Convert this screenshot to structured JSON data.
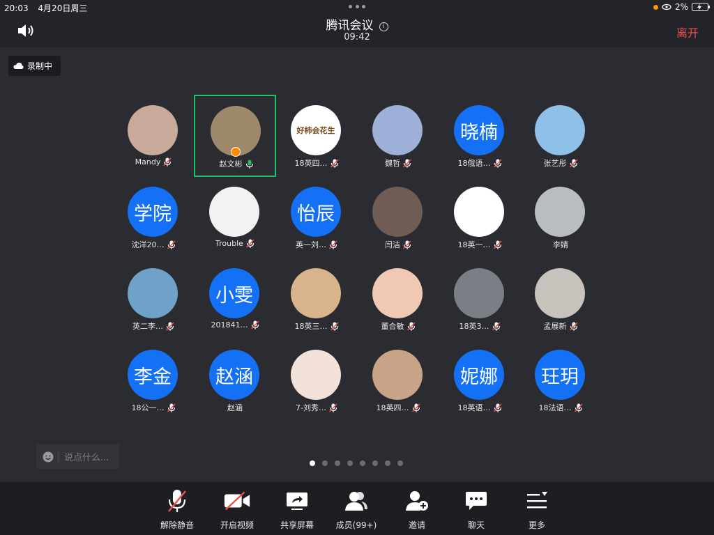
{
  "status_bar": {
    "time": "20:03",
    "date": "4月20日周三",
    "battery_percent": "2%"
  },
  "header": {
    "title": "腾讯会议",
    "timer": "09:42",
    "leave_label": "离开"
  },
  "recording_badge": "录制中",
  "participants": [
    {
      "name": "Mandy",
      "avatar_text": "",
      "avatar_color": "#c9a99a",
      "mic": "muted",
      "speaking": false
    },
    {
      "name": "赵文彬",
      "avatar_text": "",
      "avatar_color": "#9e8a6a",
      "mic": "on",
      "speaking": true
    },
    {
      "name": "18英四…",
      "avatar_text": "好柿会花生",
      "avatar_color": "#ffffff",
      "mic": "muted",
      "speaking": false
    },
    {
      "name": "魏哲",
      "avatar_text": "",
      "avatar_color": "#9fb0d8",
      "mic": "muted",
      "speaking": false
    },
    {
      "name": "18俄语…",
      "avatar_text": "晓楠",
      "avatar_color": "#1470f5",
      "mic": "muted",
      "speaking": false
    },
    {
      "name": "张艺彤",
      "avatar_text": "",
      "avatar_color": "#8fc0e8",
      "mic": "muted",
      "speaking": false
    },
    {
      "name": "沈洋20…",
      "avatar_text": "学院",
      "avatar_color": "#1470f5",
      "mic": "muted",
      "speaking": false
    },
    {
      "name": "Trouble",
      "avatar_text": "",
      "avatar_color": "#f2f2f2",
      "mic": "muted",
      "speaking": false
    },
    {
      "name": "英一刘…",
      "avatar_text": "怡辰",
      "avatar_color": "#1470f5",
      "mic": "muted",
      "speaking": false
    },
    {
      "name": "闫洁",
      "avatar_text": "",
      "avatar_color": "#6e5c55",
      "mic": "muted",
      "speaking": false
    },
    {
      "name": "18英一…",
      "avatar_text": "",
      "avatar_color": "#ffffff",
      "mic": "muted",
      "speaking": false
    },
    {
      "name": "李婧",
      "avatar_text": "",
      "avatar_color": "#b9bcc0",
      "mic": "none",
      "speaking": false
    },
    {
      "name": "英二李…",
      "avatar_text": "",
      "avatar_color": "#6fa2c8",
      "mic": "muted",
      "speaking": false
    },
    {
      "name": "201841…",
      "avatar_text": "小雯",
      "avatar_color": "#1470f5",
      "mic": "muted",
      "speaking": false
    },
    {
      "name": "18英三…",
      "avatar_text": "",
      "avatar_color": "#d9b48a",
      "mic": "muted",
      "speaking": false
    },
    {
      "name": "董合敏",
      "avatar_text": "",
      "avatar_color": "#f0c8b4",
      "mic": "muted",
      "speaking": false
    },
    {
      "name": "18英3…",
      "avatar_text": "",
      "avatar_color": "#7a7f86",
      "mic": "muted",
      "speaking": false
    },
    {
      "name": "孟展新",
      "avatar_text": "",
      "avatar_color": "#c8c2bc",
      "mic": "muted",
      "speaking": false
    },
    {
      "name": "18公一…",
      "avatar_text": "李金",
      "avatar_color": "#1470f5",
      "mic": "muted",
      "speaking": false
    },
    {
      "name": "赵涵",
      "avatar_text": "赵涵",
      "avatar_color": "#1470f5",
      "mic": "none",
      "speaking": false
    },
    {
      "name": "7-刘秀…",
      "avatar_text": "",
      "avatar_color": "#f3e2da",
      "mic": "muted",
      "speaking": false
    },
    {
      "name": "18英四…",
      "avatar_text": "",
      "avatar_color": "#c9a388",
      "mic": "muted",
      "speaking": false
    },
    {
      "name": "18英语…",
      "avatar_text": "妮娜",
      "avatar_color": "#1470f5",
      "mic": "muted",
      "speaking": false
    },
    {
      "name": "18法语…",
      "avatar_text": "玨玥",
      "avatar_color": "#1470f5",
      "mic": "muted",
      "speaking": false
    }
  ],
  "chat": {
    "placeholder": "说点什么..."
  },
  "pager": {
    "pages": 8,
    "current": 1
  },
  "toolbar": [
    {
      "label": "解除静音",
      "icon": "mic-off-icon"
    },
    {
      "label": "开启视频",
      "icon": "video-off-icon"
    },
    {
      "label": "共享屏幕",
      "icon": "share-screen-icon"
    },
    {
      "label": "成员(99+)",
      "icon": "members-icon"
    },
    {
      "label": "邀请",
      "icon": "invite-icon"
    },
    {
      "label": "聊天",
      "icon": "chat-icon"
    },
    {
      "label": "更多",
      "icon": "more-icon"
    }
  ]
}
